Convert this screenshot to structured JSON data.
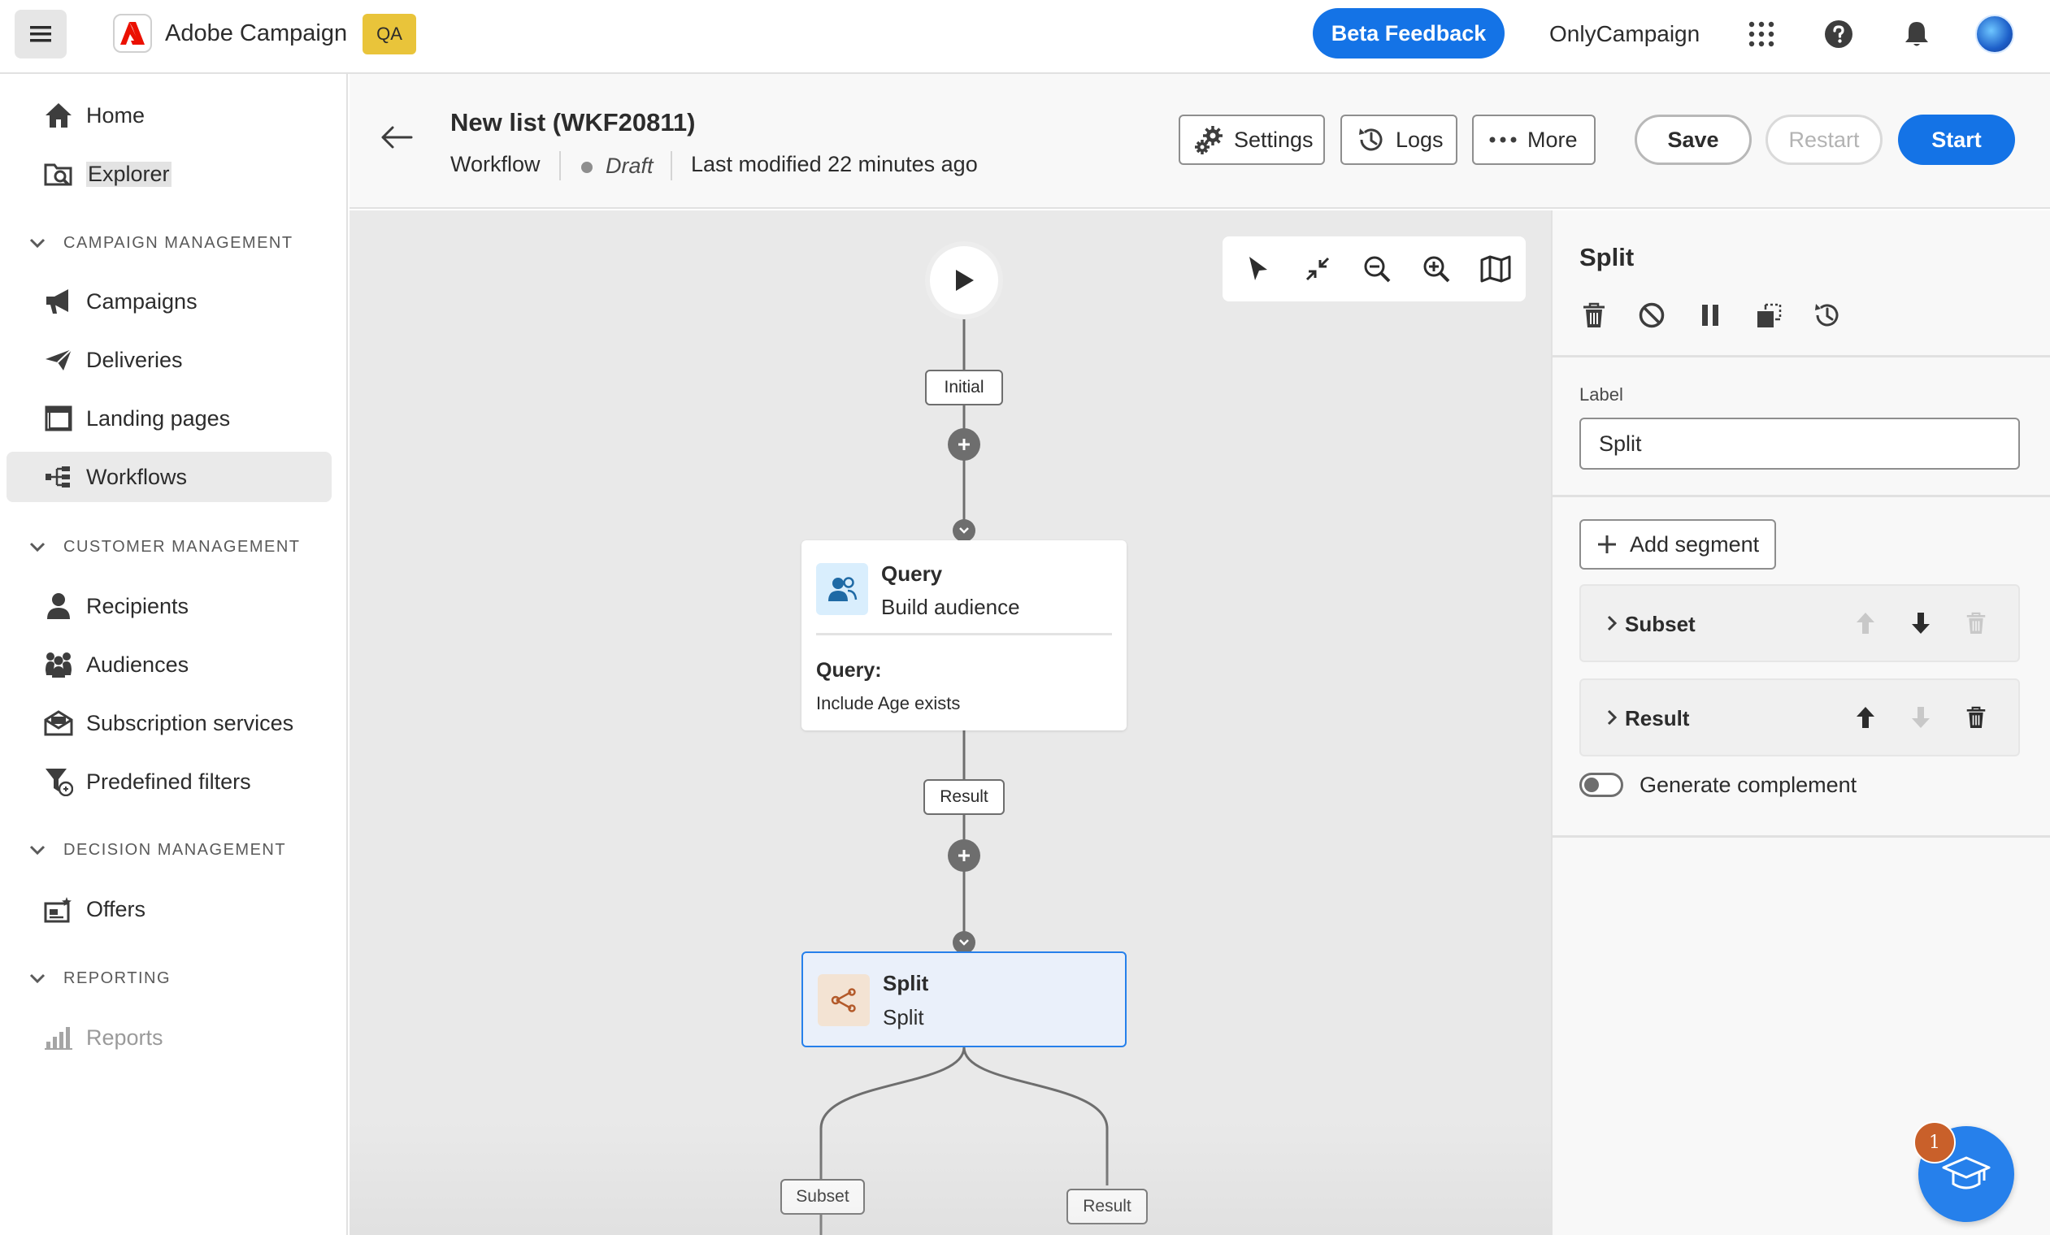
{
  "topbar": {
    "brand_name": "Adobe Campaign",
    "env_badge": "QA",
    "beta_feedback": "Beta Feedback",
    "org_name": "OnlyCampaign",
    "icons": [
      "apps-grid-icon",
      "help-icon",
      "bell-icon",
      "avatar"
    ],
    "accent": "#1473e6"
  },
  "sidebar": {
    "items": [
      {
        "label": "Home",
        "icon": "home-icon"
      },
      {
        "label": "Explorer",
        "icon": "explorer-icon"
      },
      {
        "label": "Campaigns",
        "icon": "megaphone-icon"
      },
      {
        "label": "Deliveries",
        "icon": "send-icon"
      },
      {
        "label": "Landing pages",
        "icon": "landing-page-icon"
      },
      {
        "label": "Workflows",
        "icon": "workflow-icon",
        "active": true
      },
      {
        "label": "Recipients",
        "icon": "user-icon"
      },
      {
        "label": "Audiences",
        "icon": "group-icon"
      },
      {
        "label": "Subscription services",
        "icon": "subscription-icon"
      },
      {
        "label": "Predefined filters",
        "icon": "filter-icon"
      },
      {
        "label": "Offers",
        "icon": "offer-icon"
      },
      {
        "label": "Reports",
        "icon": "chart-icon",
        "disabled": true
      }
    ],
    "sections": [
      "CAMPAIGN MANAGEMENT",
      "CUSTOMER MANAGEMENT",
      "DECISION MANAGEMENT",
      "REPORTING"
    ]
  },
  "header": {
    "title": "New list (WKF20811)",
    "type": "Workflow",
    "status": "Draft",
    "modified": "Last modified 22 minutes ago",
    "settings": "Settings",
    "logs": "Logs",
    "more": "More",
    "save": "Save",
    "restart": "Restart",
    "start": "Start"
  },
  "canvas": {
    "labels": {
      "initial": "Initial",
      "result": "Result",
      "subset": "Subset",
      "result2": "Result"
    },
    "query_card": {
      "title": "Query",
      "subtitle": "Build audience",
      "key": "Query:",
      "value": "Include Age exists"
    },
    "split_card": {
      "title": "Split",
      "subtitle": "Split"
    },
    "toolbar_icons": [
      "pointer-icon",
      "fit-icon",
      "zoom-out-icon",
      "zoom-in-icon",
      "map-icon"
    ]
  },
  "panel": {
    "title": "Split",
    "label_field": "Label",
    "label_value": "Split",
    "add_segment": "Add segment",
    "segments": [
      {
        "label": "Subset",
        "up_enabled": false,
        "down_enabled": true,
        "delete_enabled": false
      },
      {
        "label": "Result",
        "up_enabled": true,
        "down_enabled": false,
        "delete_enabled": true
      }
    ],
    "generate_complement": "Generate complement",
    "generate_complement_on": false
  },
  "help": {
    "badge": "1"
  }
}
